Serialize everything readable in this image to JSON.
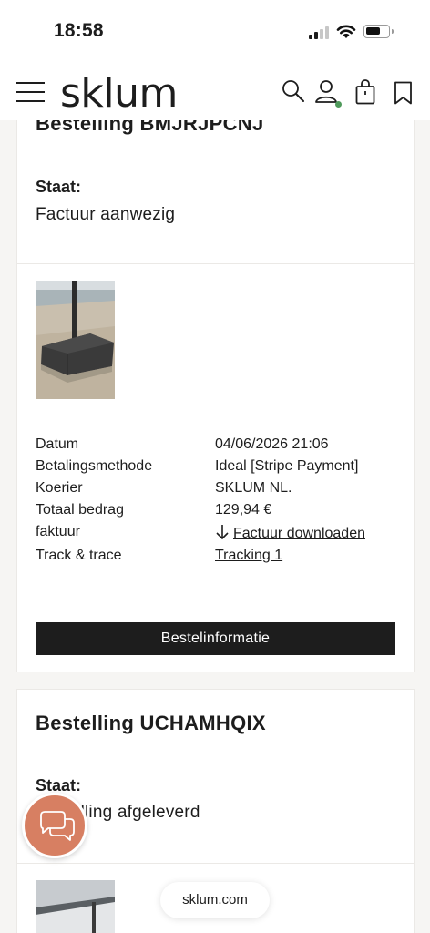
{
  "status_bar": {
    "time": "18:58"
  },
  "header": {
    "logo": "sklum"
  },
  "orders": [
    {
      "title": "Bestelling BMJRJPCNJ",
      "state_label": "Staat:",
      "state_value": "Factuur aanwezig",
      "details": [
        {
          "label": "Datum",
          "value": "04/06/2026 21:06"
        },
        {
          "label": "Betalingsmethode",
          "value": "Ideal [Stripe Payment]"
        },
        {
          "label": "Koerier",
          "value": "SKLUM NL."
        },
        {
          "label": "Totaal bedrag",
          "value": "129,94 €"
        },
        {
          "label": "faktuur",
          "value": "Factuur downloaden"
        },
        {
          "label": "Track & trace",
          "value": "Tracking 1"
        }
      ],
      "button": "Bestelinformatie"
    },
    {
      "title": "Bestelling UCHAMHQIX",
      "state_label": "Staat:",
      "state_value": "Bestelling afgeleverd"
    }
  ],
  "url_bar": {
    "url": "sklum.com"
  },
  "colors": {
    "accent": "#d77f62",
    "button": "#1d1d1d",
    "online_dot": "#4f9a5b"
  }
}
